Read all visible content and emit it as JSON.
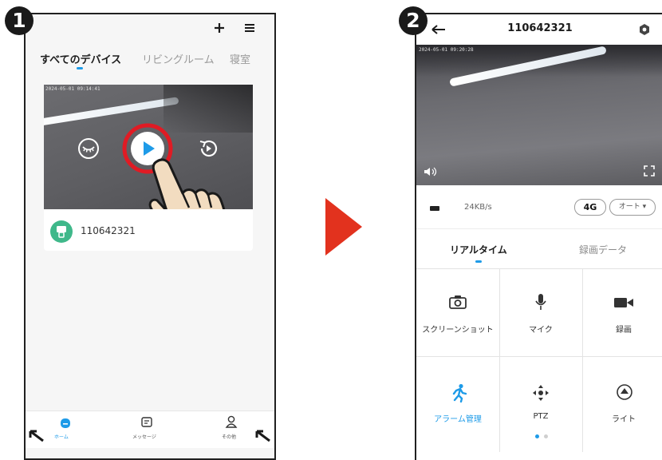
{
  "steps": {
    "first": "1",
    "second": "2"
  },
  "home": {
    "tabs": [
      "すべてのデバイス",
      "リビングルーム",
      "寝室"
    ],
    "add_icon": "plus-icon",
    "menu_icon": "menu-icon",
    "card": {
      "timestamp": "2024-05-01 09:14:41",
      "device_name": "110642321",
      "controls": [
        "sleep-eye-icon",
        "play-icon",
        "replay-icon"
      ]
    },
    "nav": [
      {
        "label": "ホーム",
        "icon": "home-icon"
      },
      {
        "label": "メッセージ",
        "icon": "message-icon"
      },
      {
        "label": "その他",
        "icon": "person-icon"
      }
    ]
  },
  "live": {
    "title": "110642321",
    "timestamp": "2024-05-01 09:20:28",
    "bitrate": "24KB/s",
    "network": "4G",
    "quality": "オート",
    "tabs": [
      "リアルタイム",
      "録画データ"
    ],
    "tiles": [
      {
        "label": "スクリーンショット",
        "icon": "camera-icon"
      },
      {
        "label": "マイク",
        "icon": "microphone-icon"
      },
      {
        "label": "録画",
        "icon": "video-record-icon"
      },
      {
        "label": "アラーム管理",
        "icon": "running-person-icon"
      },
      {
        "label": "PTZ",
        "icon": "ptz-arrows-icon"
      },
      {
        "label": "ライト",
        "icon": "light-icon"
      }
    ]
  },
  "colors": {
    "accent": "#1e9be8",
    "arrow": "#e2321e",
    "highlight": "#e01b24",
    "avatar": "#3fb88a"
  }
}
